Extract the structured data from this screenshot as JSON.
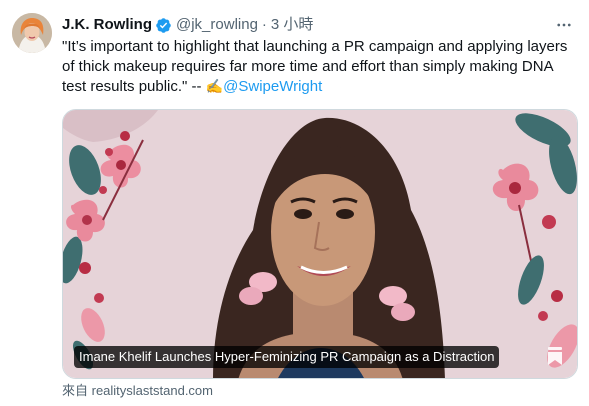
{
  "tweet": {
    "author": {
      "display_name": "J.K. Rowling",
      "verified": true,
      "handle": "@jk_rowling",
      "separator": "·",
      "time": "3 小時"
    },
    "text": "\"It’s important to highlight that launching a PR campaign and applying layers of thick makeup requires far more time and effort than simply making DNA test results public.\" -- ",
    "signature_emoji": "✍️",
    "mention": "@SwipeWright"
  },
  "card": {
    "title": "Imane Khelif Launches Hyper-Feminizing PR Campaign as a Distraction",
    "source": "來自 realityslaststand.com"
  },
  "icons": {
    "verified": "verified-badge-icon",
    "more": "more-options-icon",
    "bookmark": "bookmark-icon"
  },
  "colors": {
    "link": "#1d9bf0",
    "secondary_text": "#536471",
    "card_background": "#e6d3d8"
  }
}
